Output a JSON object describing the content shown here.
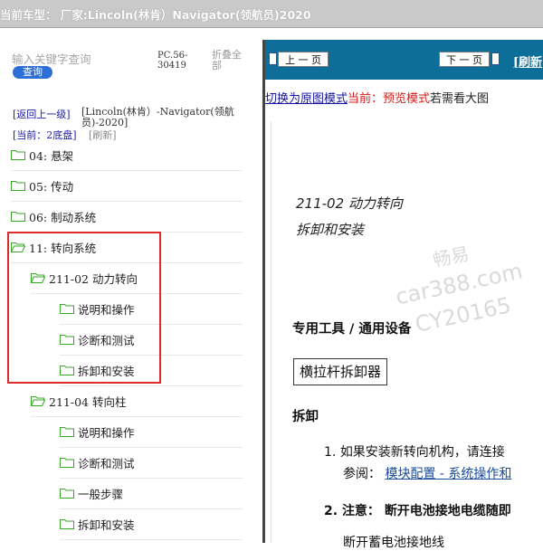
{
  "top_bar": {
    "text": "当前车型：  厂家:Lincoln(林肯）Navigator(领航员)2020"
  },
  "sidebar": {
    "search_placeholder": "输入关键字查询",
    "search_button": "查询",
    "code": "PC.56-30419",
    "collapse_all": "折叠全部",
    "back_link": "[返回上一级]",
    "vehicle": "[Lincoln(林肯）-Navigator(领航员)-2020]",
    "current": "[当前：2底盘]",
    "refresh": "[刷新]",
    "tree": [
      {
        "label": "04: 悬架",
        "level": 0
      },
      {
        "label": "05: 传动",
        "level": 0
      },
      {
        "label": "06: 制动系统",
        "level": 0
      },
      {
        "label": "11: 转向系统",
        "level": 0,
        "open": true
      },
      {
        "label": "211-02 动力转向",
        "level": 1,
        "open": true
      },
      {
        "label": "说明和操作",
        "level": 2
      },
      {
        "label": "诊断和测试",
        "level": 2
      },
      {
        "label": "拆卸和安装",
        "level": 2
      },
      {
        "label": "211-04 转向柱",
        "level": 1,
        "open": true
      },
      {
        "label": "说明和操作",
        "level": 2
      },
      {
        "label": "诊断和测试",
        "level": 2
      },
      {
        "label": "一般步骤",
        "level": 2
      },
      {
        "label": "拆卸和安装",
        "level": 2
      }
    ]
  },
  "toolbar": {
    "prev": "上 一 页",
    "next": "下 一 页",
    "refresh": "[刷新"
  },
  "mode_line": {
    "switch_link": "切换为原图模式",
    "current": "当前：预览模式",
    "hint": "若需看大图"
  },
  "document": {
    "title": "211-02 动力转向",
    "subtitle": "拆卸和安装",
    "watermark_1": "畅易",
    "watermark_2": "car388.com",
    "watermark_3": "CY20165",
    "tools_heading": "专用工具 / 通用设备",
    "tool_name": "横拉杆拆卸器",
    "removal_heading": "拆卸",
    "step1_num": "1.",
    "step1_text": "如果安装新转向机构，请连接",
    "step1_ref_label": "参阅：",
    "step1_ref_link": "模块配置 - 系统操作和",
    "step2_num": "2.",
    "step2_label": "注意：",
    "step2_text": "断开电池接地电缆随即",
    "step3_text": "断开蓄电池接地线"
  },
  "colors": {
    "nav_blue": "#0d6e9a",
    "highlight_red": "#e02b2b",
    "folder_green": "#3aa62a",
    "link_blue": "#1515a0"
  }
}
